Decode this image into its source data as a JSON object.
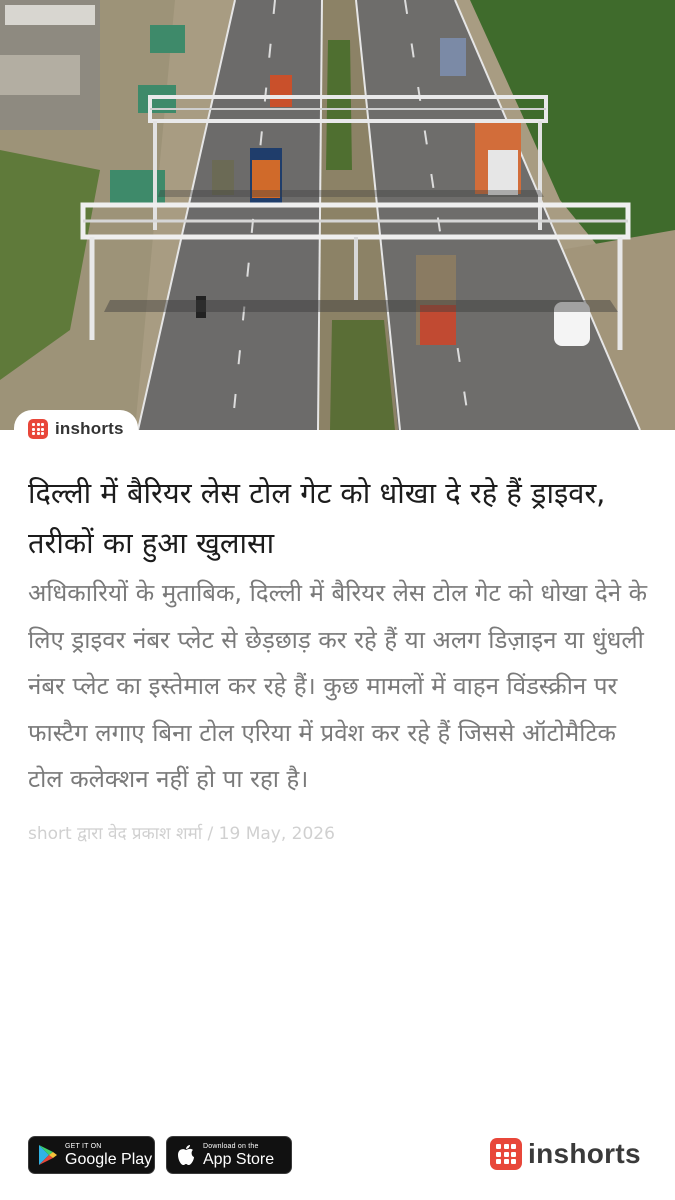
{
  "hero": {
    "image_icon": "aerial-highway-toll-gantry-photo"
  },
  "badge": {
    "icon": "inshorts-logo-icon",
    "label": "inshorts"
  },
  "article": {
    "headline": "दिल्ली में बैरियर लेस टोल गेट को धोखा दे रहे हैं ड्राइवर, तरीकों का हुआ खुलासा",
    "body": "अधिकारियों के मुताबिक, दिल्ली में बैरियर लेस टोल गेट को धोखा देने के लिए ड्राइवर नंबर प्लेट से छेड़छाड़ कर रहे हैं या अलग डिज़ाइन या धुंधली नंबर प्लेट का इस्तेमाल कर रहे हैं। कुछ मामलों में वाहन विंडस्क्रीन पर फास्टैग लगाए बिना टोल एरिया में प्रवेश कर रहे हैं जिससे ऑटोमैटिक टोल कलेक्शन नहीं हो पा रहा है।",
    "byline": "short द्वारा वेद प्रकाश शर्मा / 19 May, 2026"
  },
  "footer": {
    "google_play": {
      "small": "GET IT ON",
      "big": "Google Play",
      "icon": "google-play-icon"
    },
    "app_store": {
      "small": "Download on the",
      "big": "App Store",
      "icon": "apple-icon"
    },
    "brand": {
      "label": "inshorts",
      "icon": "inshorts-logo-icon"
    }
  },
  "colors": {
    "brand_red": "#e8473a",
    "headline": "#1c1c1c",
    "body": "#7a7a7a",
    "byline": "#d0d0d0"
  }
}
